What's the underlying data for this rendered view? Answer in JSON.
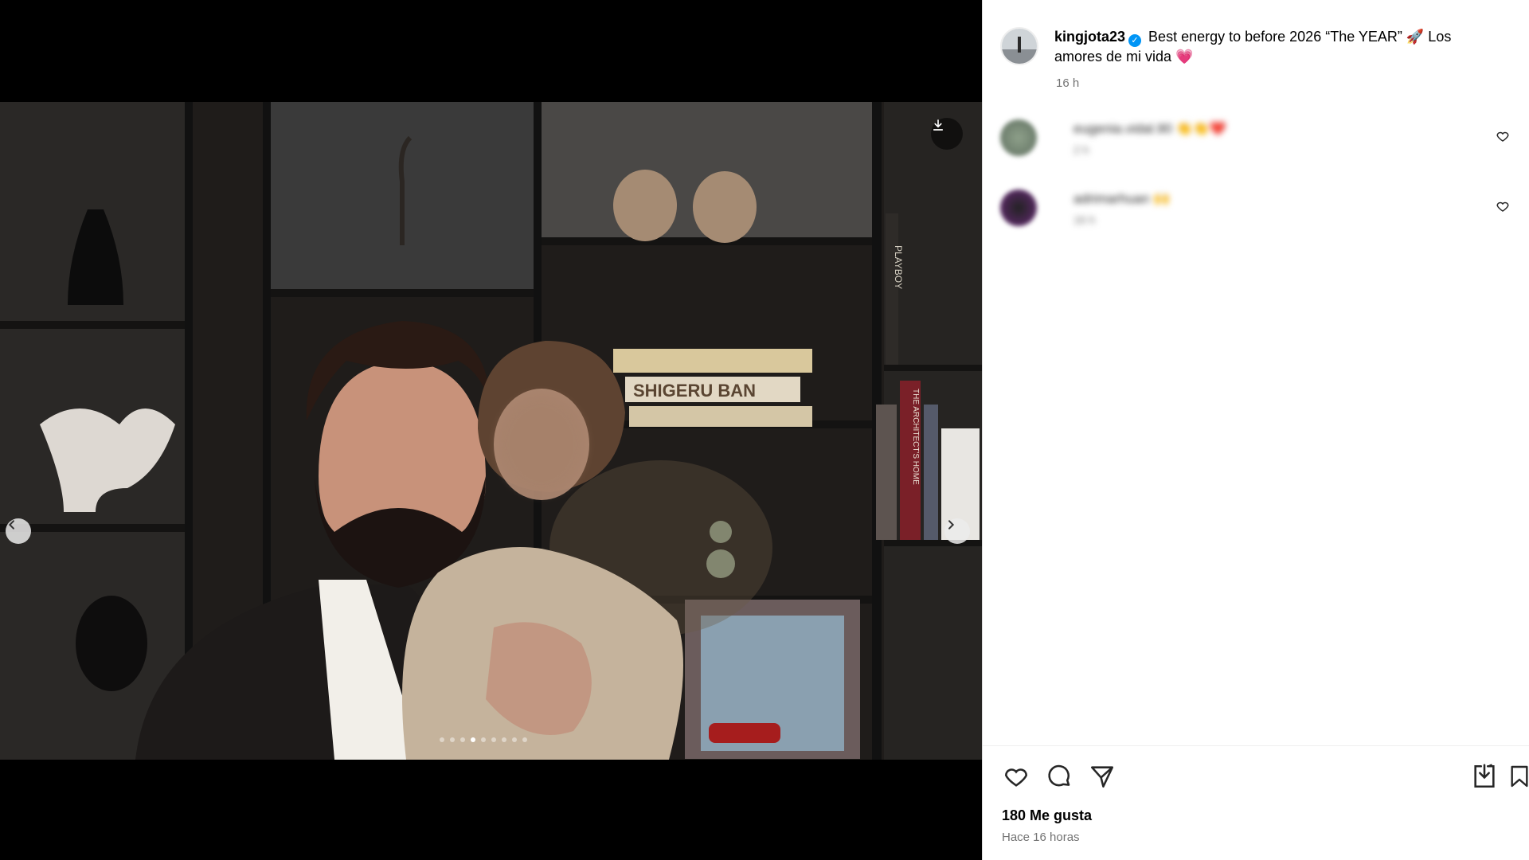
{
  "post": {
    "username": "kingjota23",
    "caption_text": "Best energy to before 2026 “The YEAR” 🚀 Los amores de mi vida 💗",
    "time": "16 h",
    "likes": "180 Me gusta",
    "posted_ago": "Hace 16 horas"
  },
  "carousel": {
    "total_slides": 9,
    "active_index": 3
  },
  "comments": [
    {
      "username": "eugenia.vidal.90",
      "text": "👏👏❤️",
      "time": "2 h"
    },
    {
      "username": "adrimarhuan",
      "text": "🙌",
      "time": "16 h"
    }
  ],
  "photo_text": {
    "book_spine_1": "SHIGERU BAN",
    "book_spine_2": "PLAYBOY",
    "book_spine_3": "THE ARCHITECT'S HOME"
  },
  "icons": [
    "download-icon",
    "chevron-left-icon",
    "chevron-right-icon",
    "heart-icon",
    "comment-icon",
    "share-icon",
    "save-to-collection-icon",
    "bookmark-icon",
    "verified-badge-icon"
  ],
  "colors": {
    "verified": "#0095f6",
    "muted": "#737373"
  }
}
